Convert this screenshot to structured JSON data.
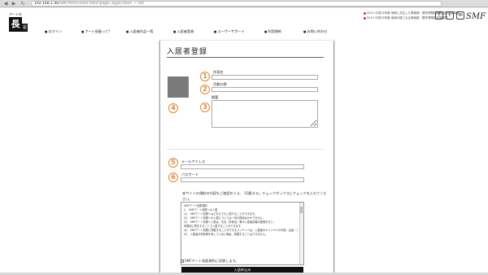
{
  "browser": {
    "back_glyph": "◀",
    "forward_glyph": "▶",
    "reload_glyph": "↻",
    "url_host": "192.168.1.40",
    "url_path": "/SMF/html/index.html?page=application — def"
  },
  "logo": {
    "top": "アートの",
    "main": "長",
    "sub": "屋"
  },
  "sponsors": [
    "2012 平成24年度 地域と共生した美術館・歴史博物館創造活動支援事業",
    "2013 平成25年度 地域の核となる美術館・歴史博物館支援事業"
  ],
  "sns": [
    "f",
    "t",
    "✉"
  ],
  "brand_right": "SMF",
  "global_nav": [
    "ログイン",
    "アート長屋って？",
    "入居者作品一覧",
    "入居者登録",
    "ユーザーサポート",
    "利用規約",
    "お問い合わせ"
  ],
  "form": {
    "title": "入居者登録",
    "numbers": [
      "1",
      "2",
      "3",
      "4",
      "5",
      "6"
    ],
    "labels": {
      "artist_name": "作家名",
      "genre": "活動分野",
      "summary": "概要",
      "email": "メールアドレス",
      "password": "パスワード"
    },
    "notice": "本サイトの規約の内容をご確認のうえ、「同意する」チェックボックスにチェックを入れてください。",
    "terms": [
      "SMFアート長屋規約",
      "",
      "1.　SMFアート長屋への入居",
      "",
      "(1)　SMFアート長屋へはどなたでも入居することができます。",
      "(2)　SMFアート長屋への入居については一切の費用はかかりません。",
      "(3)　SMFアート長屋へ入居は、氏名（作家名）等の入居者情報の登録を行い、",
      "本規約に同意することで入居することができます。",
      "(4)　SMFアート長屋に掲載することができるコンテンツは、入居者のオリジナルの作品・企画・アイデアであることとします。",
      "(5)　入居者が作品等を有していない場合、掲載することはできません。"
    ],
    "agree_label": "SMFアート長屋規約に同意します。",
    "submit_label": "入居申込み"
  },
  "colors": {
    "accent_orange": "#d83",
    "avatar_gray": "#7a7a7a",
    "button_black": "#111111"
  }
}
